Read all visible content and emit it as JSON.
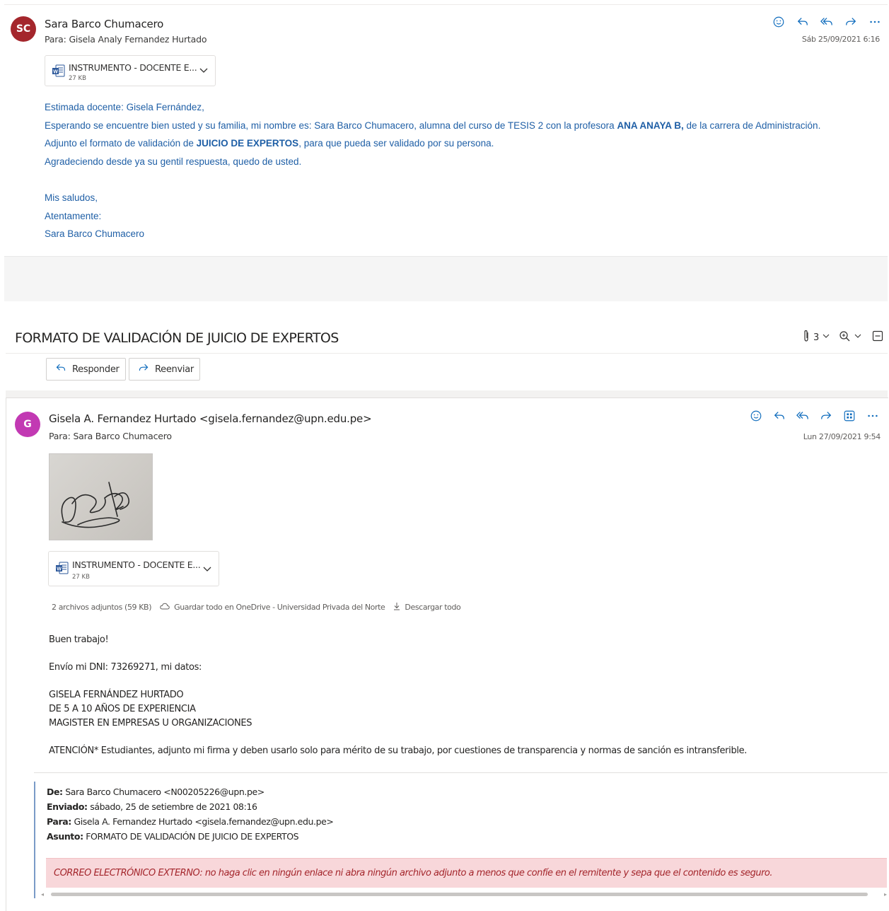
{
  "message1": {
    "avatar_initials": "SC",
    "avatar_color": "#a4262c",
    "sender": "Sara Barco Chumacero",
    "to_label": "Para:",
    "to": "Gisela Analy Fernandez Hurtado",
    "date": "Sáb 25/09/2021 6:16",
    "attachment": {
      "name": "INSTRUMENTO - DOCENTE E...",
      "size": "27 KB"
    },
    "body": {
      "greeting": "Estimada docente: Gisela Fernández,",
      "line2_a": "Esperando se encuentre bien usted y su familia, mi nombre es: Sara Barco Chumacero, alumna del curso de TESIS 2 con la profesora ",
      "line2_bold": "ANA ANAYA B,",
      "line2_b": " de la carrera de Administración.",
      "line3_a": "Adjunto el formato de validación de ",
      "line3_bold": "JUICIO DE EXPERTOS",
      "line3_b": ", para que pueda ser validado por su persona.",
      "line4": "Agradeciendo desde ya su gentil respuesta, quedo de usted.",
      "closing1": "Mis saludos,",
      "closing2": "Atentamente:",
      "closing3": "Sara Barco Chumacero"
    }
  },
  "thread": {
    "subject": "FORMATO DE VALIDACIÓN DE JUICIO DE EXPERTOS",
    "attach_count": "3",
    "reply_label": "Responder",
    "forward_label": "Reenviar"
  },
  "message2": {
    "avatar_initials": "G",
    "avatar_color": "#c239b3",
    "sender": "Gisela A. Fernandez Hurtado <gisela.fernandez@upn.edu.pe>",
    "to_label": "Para:",
    "to": "Sara Barco Chumacero",
    "date": "Lun 27/09/2021 9:54",
    "attachment": {
      "name": "INSTRUMENTO - DOCENTE E...",
      "size": "27 KB"
    },
    "attachments_summary": "2 archivos adjuntos (59 KB)",
    "save_onedrive": "Guardar todo en OneDrive - Universidad Privada del Norte",
    "download_all": "Descargar todo",
    "body": {
      "line1": "Buen trabajo!",
      "line2": "Envío mi DNI: 73269271, mi datos:",
      "line3": "GISELA FERNÁNDEZ HURTADO",
      "line4": "DE 5 A 10 AÑOS DE EXPERIENCIA",
      "line5": "MAGISTER EN EMPRESAS U ORGANIZACIONES",
      "line6": "ATENCIÓN* Estudiantes, adjunto mi firma y deben usarlo solo para mérito de su trabajo, por cuestiones de transparencia y normas de sanción es intransferible."
    },
    "quoted": {
      "from_label": "De:",
      "from": "Sara Barco Chumacero <N00205226@upn.pe>",
      "sent_label": "Enviado:",
      "sent": "sábado, 25 de setiembre de 2021 08:16",
      "to_label": "Para:",
      "to": "Gisela A. Fernandez Hurtado <gisela.fernandez@upn.edu.pe>",
      "subject_label": "Asunto:",
      "subject": "FORMATO DE VALIDACIÓN DE JUICIO DE EXPERTOS"
    },
    "warning": "CORREO ELECTRÓNICO EXTERNO: no haga clic en ningún enlace ni abra ningún archivo adjunto a menos que confíe en el remitente y sepa que el contenido es seguro."
  },
  "colors": {
    "accent": "#0078d4",
    "body_blue": "#1f5fa6",
    "warning_bg": "#f8d7da",
    "warning_text": "#a4262c"
  }
}
